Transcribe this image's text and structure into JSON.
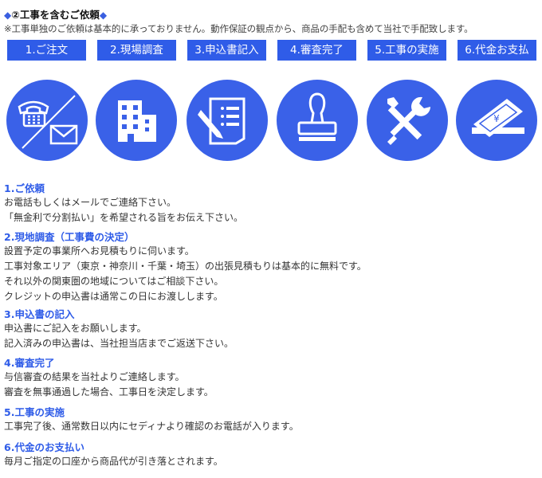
{
  "header": {
    "title_prefix": "◆",
    "title_text": "②工事を含むご依頼",
    "title_suffix": "◆",
    "note": "※工事単独のご依頼は基本的に承っておりません。動作保証の観点から、商品の手配も含めて当社で手配致します。"
  },
  "steps": [
    {
      "label": "1.ご注文"
    },
    {
      "label": "2.現場調査"
    },
    {
      "label": "3.申込書記入"
    },
    {
      "label": "4.審査完了"
    },
    {
      "label": "5.工事の実施"
    },
    {
      "label": "6.代金お支払"
    }
  ],
  "icons": [
    {
      "name": "phone-mail-icon"
    },
    {
      "name": "building-icon"
    },
    {
      "name": "form-pen-icon"
    },
    {
      "name": "stamp-icon"
    },
    {
      "name": "tools-icon"
    },
    {
      "name": "money-icon"
    }
  ],
  "colors": {
    "accent": "#2f5ce8",
    "icon_bg": "#3a61e8"
  },
  "sections": [
    {
      "heading": "1.ご依頼",
      "lines": [
        "お電話もしくはメールでご連絡下さい。",
        "「無金利で分割払い」を希望される旨をお伝え下さい。"
      ]
    },
    {
      "heading": "2.現地調査（工事費の決定）",
      "lines": [
        "設置予定の事業所へお見積もりに伺います。",
        "工事対象エリア（東京・神奈川・千葉・埼玉）の出張見積もりは基本的に無料です。",
        "それ以外の関東圏の地域についてはご相談下さい。",
        "クレジットの申込書は通常この日にお渡しします。"
      ]
    },
    {
      "heading": "3.申込書の記入",
      "lines": [
        "申込書にご記入をお願いします。",
        "記入済みの申込書は、当社担当店までご返送下さい。"
      ]
    },
    {
      "heading": "4.審査完了",
      "lines": [
        "与信審査の結果を当社よりご連絡します。",
        "審査を無事通過した場合、工事日を決定します。"
      ]
    },
    {
      "heading": "5.工事の実施",
      "lines": [
        "工事完了後、通常数日以内にセディナより確認のお電話が入ります。"
      ]
    },
    {
      "heading": "6.代金のお支払い",
      "lines": [
        "毎月ご指定の口座から商品代が引き落とされます。"
      ]
    }
  ]
}
